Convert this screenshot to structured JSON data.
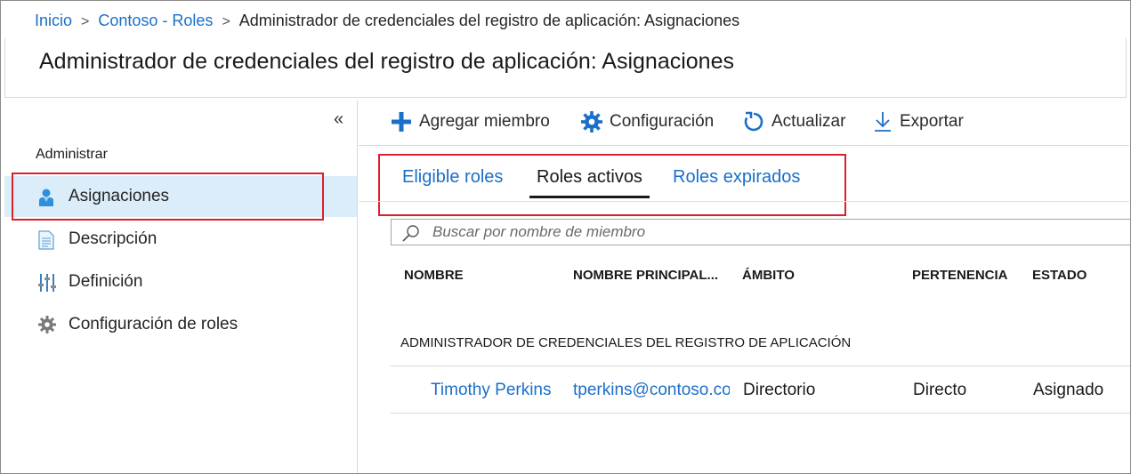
{
  "breadcrumb": {
    "items": [
      "Inicio",
      "Contoso - Roles"
    ],
    "current": "Administrador de credenciales del registro de aplicación: Asignaciones"
  },
  "page": {
    "title": "Administrador de credenciales del registro de aplicación: Asignaciones"
  },
  "sidebar": {
    "collapse_glyph": "«",
    "section_label": "Administrar",
    "items": [
      {
        "label": "Asignaciones",
        "icon": "user-icon",
        "active": true
      },
      {
        "label": "Descripción",
        "icon": "document-icon"
      },
      {
        "label": "Definición",
        "icon": "sliders-icon"
      },
      {
        "label": "Configuración de roles",
        "icon": "gear-icon"
      }
    ]
  },
  "toolbar": {
    "add_member": "Agregar miembro",
    "settings": "Configuración",
    "refresh": "Actualizar",
    "export": "Exportar"
  },
  "tabs": [
    {
      "label": "Eligible roles"
    },
    {
      "label": "Roles activos",
      "active": true
    },
    {
      "label": "Roles expirados"
    }
  ],
  "search": {
    "placeholder": "Buscar por nombre de miembro"
  },
  "table": {
    "headers": [
      "NOMBRE",
      "NOMBRE PRINCIPAL...",
      "ÁMBITO",
      "PERTENENCIA",
      "ESTADO"
    ],
    "group_label": "ADMINISTRADOR DE CREDENCIALES DEL REGISTRO DE APLICACIÓN",
    "rows": [
      {
        "name": "Timothy Perkins",
        "principal": "tperkins@contoso.com",
        "scope": "Directorio",
        "membership": "Directo",
        "state": "Asignado"
      }
    ]
  },
  "colors": {
    "link": "#1a6fc9",
    "active_nav_bg": "#dcedfa",
    "highlight_box": "#d9202b",
    "accent": "#0f6cbd"
  }
}
